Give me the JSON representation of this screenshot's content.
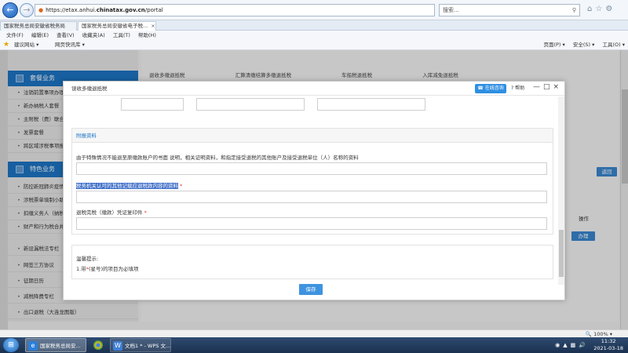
{
  "browser": {
    "url_prefix": "https://etax.anhui.",
    "url_bold": "chinatax.gov.cn",
    "url_suffix": "/portal",
    "search_placeholder": "搜索...",
    "tabs": [
      {
        "label": "国家税务总局安徽省税务局"
      },
      {
        "label": "国家税务总局安徽省电子税..."
      }
    ],
    "menu": [
      "文件(F)",
      "编辑(E)",
      "查看(V)",
      "收藏夹(A)",
      "工具(T)",
      "帮助(H)"
    ],
    "favorites": [
      "建议网站 ▾",
      "网页快讯库 ▾"
    ],
    "right_tools": [
      "页面(P) ▾",
      "安全(S) ▾",
      "工具(O) ▾"
    ],
    "zoom": "100%"
  },
  "sidebar": {
    "head1": "套餐业务",
    "head2": "特色业务",
    "items_top": [
      "注销前置事项办理",
      "新办纳税人套餐",
      "主附税（费）联合申报",
      "发票套餐",
      "跨区域涉税事项报告"
    ],
    "items_bottom": [
      "防控新冠肺炎疫情",
      "涉税票单填制小助手",
      "扣缴义务人（纳税人）",
      "财产和行为税合并申报",
      "新设漏税法专栏",
      "网签三方协议",
      "征期日历",
      "减税降费专栏",
      "出口退税（大连龙图版）"
    ]
  },
  "background": {
    "links": [
      "退收多缴退抵税",
      "汇算清缴结算多缴退抵税",
      "车船税退抵税",
      "入库减免退抵税"
    ],
    "return_button": "返回",
    "op_header": "操作",
    "handle_button": "办理"
  },
  "modal": {
    "title": "误收多缴退抵税",
    "online_button": "在线咨询",
    "help_button": "帮助",
    "section_title": "附报资料",
    "fields": [
      {
        "label": "由于特殊情况不能退至原缴款账户的书面 说明，相关证明资料，和指定接受退税的其他账户及接受退税单位（人）名称的资料",
        "required": false
      },
      {
        "label": "税务机关认可的其他记载应退税款内容的资料",
        "required": true
      },
      {
        "label": "退税完税（缴款）凭证复印件",
        "required": true
      }
    ],
    "required_mark": "*",
    "tips_title": "温馨提示:",
    "tips_prefix": "1.带",
    "tips_star": "*",
    "tips_suffix": "(星号)的项目为必填项",
    "save_button": "保存"
  },
  "taskbar": {
    "ie_label": "国家税务总局安...",
    "wps_label": "文档1 * - WPS 文...",
    "time": "11:32",
    "date": "2021-03-18"
  }
}
